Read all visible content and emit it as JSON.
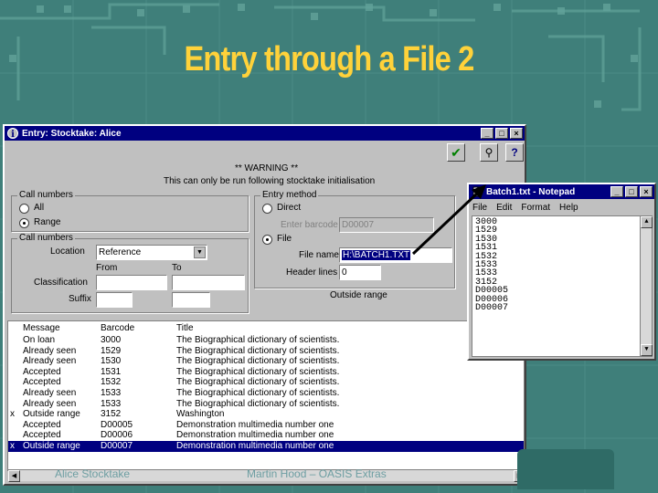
{
  "slide": {
    "title": "Entry through a File 2",
    "footer_left": "Alice Stocktake",
    "footer_center": "Martin Hood – OASIS Extras"
  },
  "colors": {
    "background": "#3f7f7a",
    "title": "#ffd23a",
    "titlebar": "#000080"
  },
  "main_window": {
    "title": "Entry: Stocktake: Alice",
    "warning_line1": "** WARNING **",
    "warning_line2": "This can only be run following stocktake initialisation",
    "call_numbers_group": {
      "legend": "Call numbers",
      "options": [
        "All",
        "Range"
      ],
      "selected": "Range"
    },
    "call_numbers_range": {
      "legend": "Call numbers",
      "location_label": "Location",
      "location_value": "Reference",
      "from_label": "From",
      "to_label": "To",
      "classification_label": "Classification",
      "suffix_label": "Suffix"
    },
    "entry_method": {
      "legend": "Entry method",
      "options": [
        "Direct",
        "File"
      ],
      "selected": "File",
      "enter_barcode_label": "Enter barcode",
      "enter_barcode_value": "D00007",
      "file_name_label": "File name",
      "file_name_value": "H:\\BATCH1.TXT",
      "header_lines_label": "Header lines",
      "header_lines_value": "0",
      "outside_range_label": "Outside range"
    },
    "toolbar": [
      "check-icon",
      "binoculars-icon",
      "help-icon"
    ],
    "results": {
      "columns": [
        "Message",
        "Barcode",
        "Title"
      ],
      "rows": [
        {
          "mark": "",
          "message": "On loan",
          "barcode": "3000",
          "title": "The Biographical dictionary of scientists."
        },
        {
          "mark": "",
          "message": "Already seen",
          "barcode": "1529",
          "title": "The Biographical dictionary of scientists."
        },
        {
          "mark": "",
          "message": "Already seen",
          "barcode": "1530",
          "title": "The Biographical dictionary of scientists."
        },
        {
          "mark": "",
          "message": "Accepted",
          "barcode": "1531",
          "title": "The Biographical dictionary of scientists."
        },
        {
          "mark": "",
          "message": "Accepted",
          "barcode": "1532",
          "title": "The Biographical dictionary of scientists."
        },
        {
          "mark": "",
          "message": "Already seen",
          "barcode": "1533",
          "title": "The Biographical dictionary of scientists."
        },
        {
          "mark": "",
          "message": "Already seen",
          "barcode": "1533",
          "title": "The Biographical dictionary of scientists."
        },
        {
          "mark": "x",
          "message": "Outside range",
          "barcode": "3152",
          "title": "Washington"
        },
        {
          "mark": "",
          "message": "Accepted",
          "barcode": "D00005",
          "title": "Demonstration multimedia number one"
        },
        {
          "mark": "",
          "message": "Accepted",
          "barcode": "D00006",
          "title": "Demonstration multimedia number one"
        },
        {
          "mark": "x",
          "message": "Outside range",
          "barcode": "D00007",
          "title": "Demonstration multimedia number one"
        }
      ],
      "selected_row": 10
    }
  },
  "notepad": {
    "title": "Batch1.txt - Notepad",
    "menu": [
      "File",
      "Edit",
      "Format",
      "Help"
    ],
    "lines": [
      "3000",
      "1529",
      "1530",
      "1531",
      "1532",
      "1533",
      "1533",
      "3152",
      "D00005",
      "D00006",
      "D00007"
    ]
  }
}
